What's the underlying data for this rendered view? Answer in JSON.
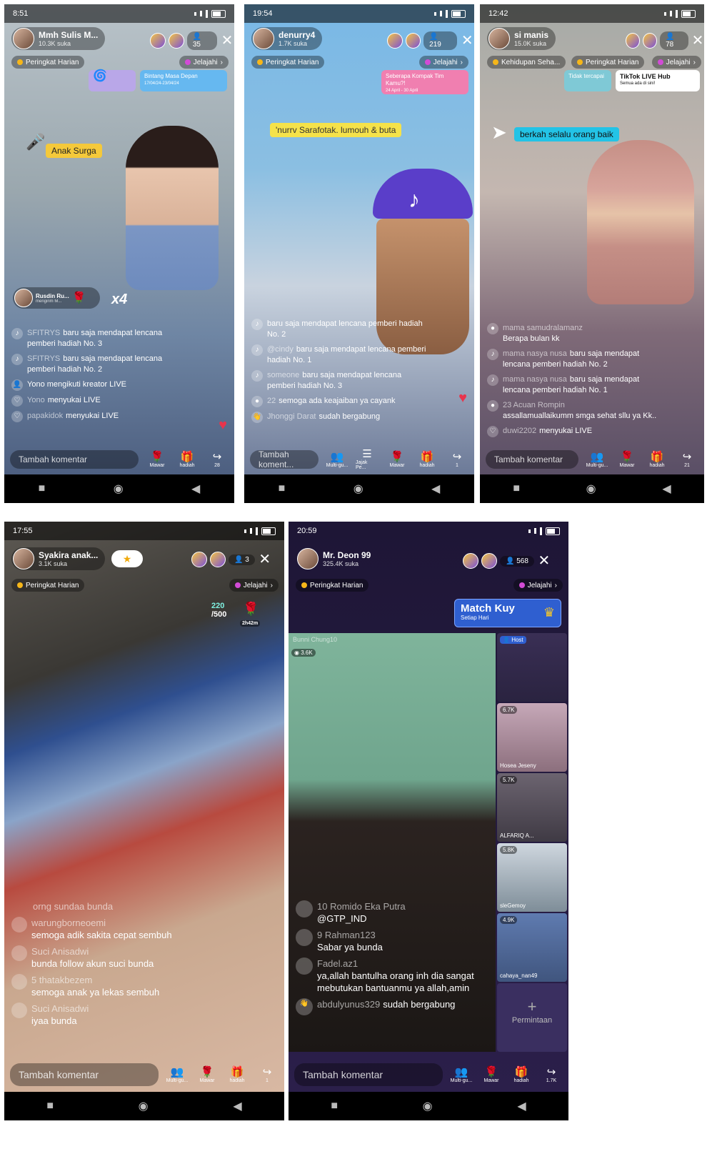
{
  "shared": {
    "peringkat": "Peringkat Harian",
    "jelajahi": "Jelajahi",
    "tambah": "Tambah komentar",
    "hadiah": "hadiah",
    "mawar": "Mawar",
    "multiguest": "Multi-gu..."
  },
  "p1": {
    "time": "8:51",
    "host_name": "Mmh Sulis M...",
    "host_likes": "10.3K suka",
    "viewers": "35",
    "card_a": "Bintang Masa Depan",
    "card_a_date": "17/04/24-23/04/24",
    "sticker": "Anak Surga",
    "gift_name": "Rusdin Ru...",
    "gift_sub": "mengirim M...",
    "gift_count": "x4",
    "comments": [
      {
        "u": "SFITRYS",
        "t": "baru saja mendapat lencana pemberi hadiah No. 3"
      },
      {
        "u": "SFITRYS",
        "t": "baru saja mendapat lencana pemberi hadiah No. 2"
      },
      {
        "u": "",
        "t": "Yono mengikuti kreator LIVE"
      },
      {
        "u": "Yono",
        "t": "menyukai LIVE"
      },
      {
        "u": "papakidok",
        "t": "menyukai LIVE"
      }
    ],
    "share_count": "28"
  },
  "p2": {
    "time": "19:54",
    "host_name": "denurry4",
    "host_likes": "1.7K suka",
    "viewers": "219",
    "card_a": "Seberapa Kompak Tim Kamu?!",
    "card_a_date": "24 April - 30 April",
    "sticker": "'nurrv Sarafotak. lumouh & buta",
    "comments": [
      {
        "u": "",
        "t": "baru saja mendapat lencana pemberi hadiah No. 2"
      },
      {
        "u": "@cindy",
        "t": "baru saja mendapat lencana pemberi hadiah No. 1"
      },
      {
        "u": "someone",
        "t": "baru saja mendapat lencana pemberi hadiah No. 3"
      },
      {
        "u": "22",
        "t": "semoga ada keajaiban ya cayank"
      },
      {
        "u": "Jhonggi Darat",
        "t": "sudah bergabung"
      }
    ],
    "tambah": "Tambah koment...",
    "jajak": "Jajak Pe...",
    "share_count": "1"
  },
  "p3": {
    "time": "12:42",
    "host_name": "si manis",
    "host_likes": "15.0K suka",
    "viewers": "78",
    "pill_a": "Kehidupan Seha...",
    "card_a": "Tidak tercapai",
    "card_b": "TikTok LIVE Hub",
    "card_b_sub": "Semua ada di sini!",
    "sticker": "berkah selalu orang baik",
    "comments": [
      {
        "u": "mama samudralamanz",
        "t": "Berapa bulan kk"
      },
      {
        "u": "mama nasya nusa",
        "t": "baru saja mendapat lencana pemberi hadiah No. 2"
      },
      {
        "u": "mama nasya nusa",
        "t": "baru saja mendapat lencana pemberi hadiah No. 1"
      },
      {
        "u": "23 Acuan Rompin",
        "t": "assallamuallaikumm smga sehat sllu ya Kk.."
      },
      {
        "u": "duwi2202",
        "t": "menyukai LIVE"
      }
    ],
    "share_count": "21"
  },
  "p4": {
    "time": "17:55",
    "host_name": "Syakira anak...",
    "host_likes": "3.1K suka",
    "viewers": "3",
    "goal": "220",
    "goal_total": "/500",
    "goal_time": "2h42m",
    "comments": [
      {
        "u": "orng sundaa bunda",
        "t": ""
      },
      {
        "u": "warungborneoemi",
        "t": "semoga adik sakita cepat sembuh"
      },
      {
        "u": "Suci Anisadwi",
        "t": "bunda follow akun suci bunda"
      },
      {
        "u": "5 thatakbezem",
        "t": "semoga anak ya lekas sembuh"
      },
      {
        "u": "Suci Anisadwi",
        "t": "iyaa bunda"
      }
    ],
    "share_count": "1"
  },
  "p5": {
    "time": "20:59",
    "host_name": "Mr. Deon 99",
    "host_likes": "325.4K suka",
    "viewers": "568",
    "match": "Match Kuy",
    "match_sub": "Setiap Hari",
    "main_views": "3.6K",
    "main_name": "Bunni Chung10",
    "host_tag": "Host",
    "tiles": [
      {
        "v": "6.7K",
        "n": "Hosea Jeseny"
      },
      {
        "v": "5.7K",
        "n": "ALFARIQ A..."
      },
      {
        "v": "5.8K",
        "n": "sleGemoy"
      },
      {
        "v": "4.9K",
        "n": "cahaya_nan49"
      }
    ],
    "request": "Permintaan",
    "comments": [
      {
        "u": "10 Romido Eka Putra",
        "t": "@GTP_IND"
      },
      {
        "u": "9 Rahman123",
        "t": "Sabar ya bunda"
      },
      {
        "u": "Fadel.az1",
        "t": "ya,allah bantulha orang inh dia sangat mebutukan bantuanmu ya allah,amin"
      },
      {
        "u": "abdulyunus329",
        "t": "sudah bergabung"
      }
    ],
    "share_count": "1.7K"
  }
}
